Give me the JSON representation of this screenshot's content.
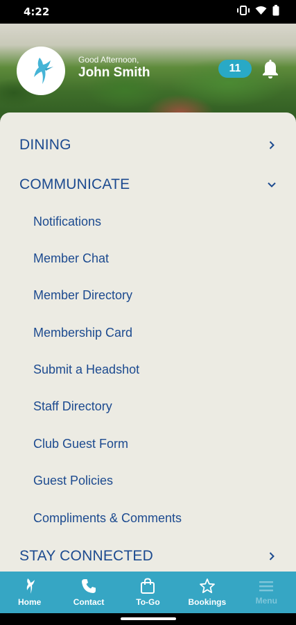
{
  "status": {
    "time": "4:22",
    "icons": [
      "vibrate-icon",
      "wifi-icon",
      "battery-icon"
    ]
  },
  "header": {
    "greeting": "Good Afternoon,",
    "name": "John Smith",
    "notification_count": "11",
    "logo": "hummingbird-logo"
  },
  "menu": {
    "sections": [
      {
        "label": "DINING",
        "expanded": false
      },
      {
        "label": "COMMUNICATE",
        "expanded": true
      },
      {
        "label": "STAY CONNECTED",
        "expanded": false
      }
    ],
    "communicate_items": [
      "Notifications",
      "Member Chat",
      "Member Directory",
      "Membership Card",
      "Submit a Headshot",
      "Staff Directory",
      "Club Guest Form",
      "Guest Policies",
      "Compliments & Comments"
    ]
  },
  "tabs": [
    {
      "label": "Home",
      "icon": "hummingbird-icon",
      "active": false
    },
    {
      "label": "Contact",
      "icon": "phone-icon",
      "active": false
    },
    {
      "label": "To-Go",
      "icon": "shopping-bag-icon",
      "active": false
    },
    {
      "label": "Bookings",
      "icon": "star-icon",
      "active": false
    },
    {
      "label": "Menu",
      "icon": "hamburger-icon",
      "active": true
    }
  ],
  "colors": {
    "accent": "#36a6c4",
    "badge": "#29a9c6",
    "menu_text": "#1c4a8f",
    "panel_bg": "#ecebe3"
  }
}
